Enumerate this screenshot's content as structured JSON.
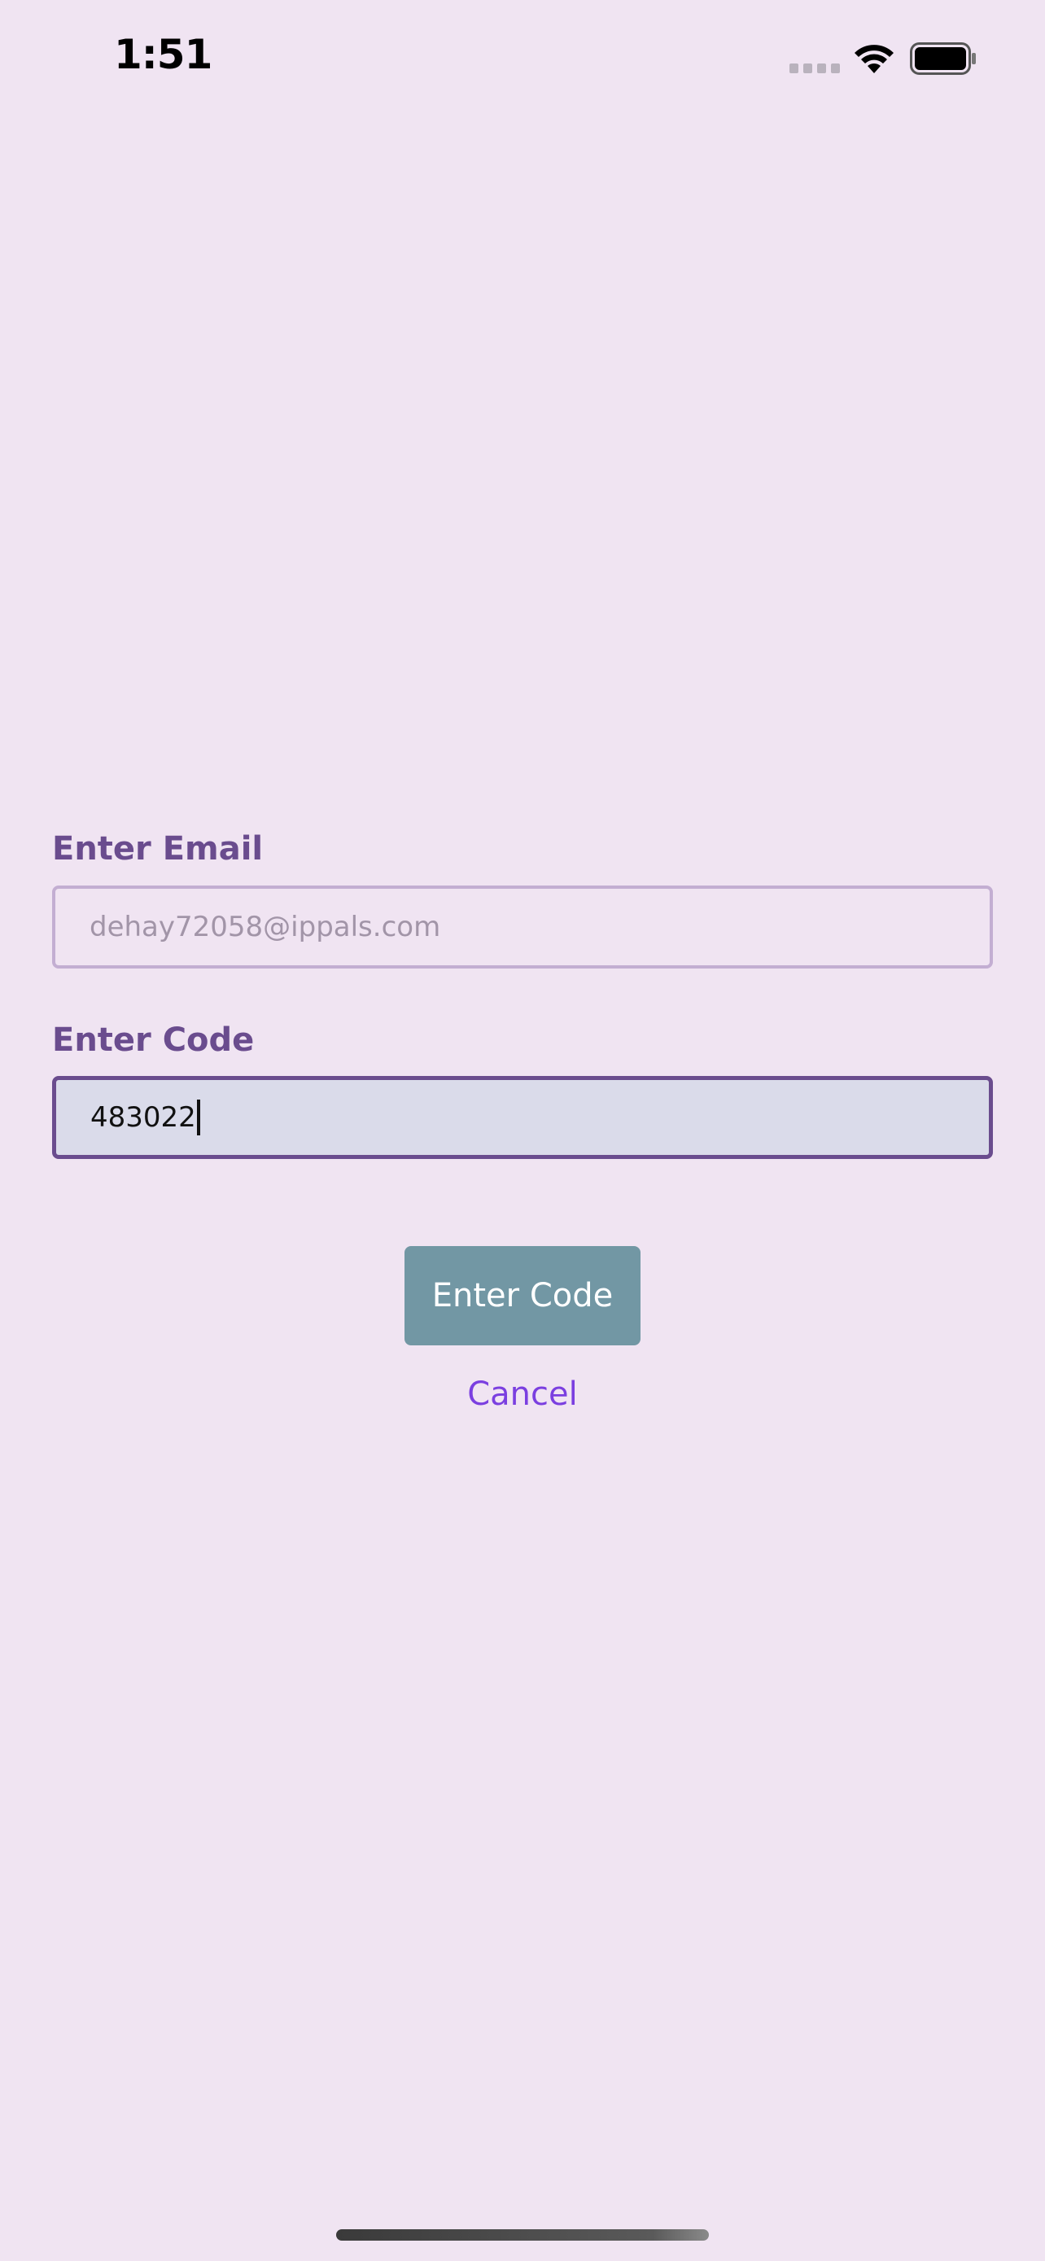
{
  "status_bar": {
    "time": "1:51",
    "icons": [
      "signal-icon",
      "wifi-icon",
      "battery-icon"
    ]
  },
  "form": {
    "email_label": "Enter Email",
    "email_value": "dehay72058@ippals.com",
    "code_label": "Enter Code",
    "code_value": "483022"
  },
  "actions": {
    "submit_label": "Enter Code",
    "cancel_label": "Cancel"
  },
  "colors": {
    "background": "#f0e4f2",
    "label": "#6a4c8e",
    "button": "#7297a4",
    "link": "#7b3fe0"
  }
}
